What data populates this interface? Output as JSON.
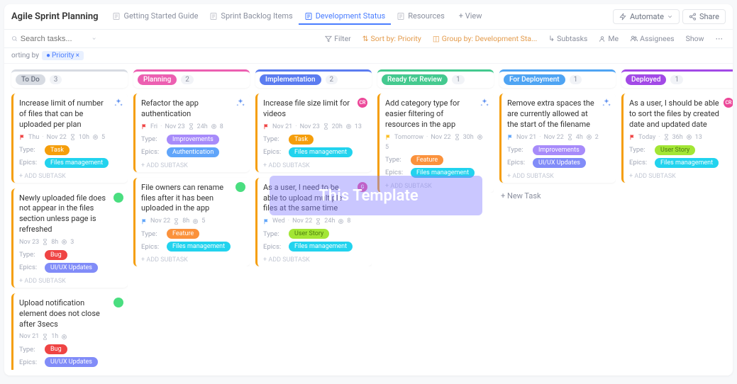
{
  "title": "Agile Sprint Planning",
  "tabs": [
    {
      "label": "Getting Started Guide",
      "active": false
    },
    {
      "label": "Sprint Backlog Items",
      "active": false
    },
    {
      "label": "Development Status",
      "active": true
    },
    {
      "label": "Resources",
      "active": false
    }
  ],
  "add_view": "+ View",
  "top_buttons": {
    "automate": "Automate",
    "share": "Share"
  },
  "toolbar": {
    "search_placeholder": "Search tasks...",
    "filter": "Filter",
    "sort": "Sort by: Priority",
    "group": "Group by: Development Sta...",
    "subtasks": "Subtasks",
    "me": "Me",
    "assignees": "Assignees",
    "show": "Show"
  },
  "sortbar": {
    "prefix": "orting by",
    "chip": "Priority"
  },
  "columns": [
    {
      "name": "To Do",
      "color": "#d7dbe2",
      "count": 3,
      "muted": true
    },
    {
      "name": "Planning",
      "color": "#ec5fb1",
      "count": 2
    },
    {
      "name": "Implementation",
      "color": "#5b7cf0",
      "count": 2
    },
    {
      "name": "Ready for Review",
      "color": "#44c98f",
      "count": 1
    },
    {
      "name": "For Deployment",
      "color": "#4fa4f3",
      "count": 1
    },
    {
      "name": "Deployed",
      "color": "#a249e6",
      "count": 1
    }
  ],
  "prio_colors": {
    "urgent": "#ef4444",
    "high": "#f59e0b",
    "normal": "#60a5fa",
    "low": "#9ca3af"
  },
  "cards": {
    "c0": [
      {
        "title": "Increase limit of number of files that can be uploaded per plan",
        "icon": "sparkle",
        "p": "#f59e0b",
        "flagc": "mflag-red",
        "meta": [
          "Thu",
          "·",
          "Nov 22",
          "⧖",
          "10h",
          "◎",
          "5"
        ],
        "type": "task",
        "typeL": "Task",
        "epic": "fm",
        "epicL": "Files management"
      },
      {
        "title": "Newly uploaded file does not appear in the files section unless page is refreshed",
        "icon": "avatar",
        "p": "#f59e0b",
        "meta": [
          "Nov 23",
          "⧖",
          "8h",
          "◎",
          "3"
        ],
        "type": "bug",
        "typeL": "Bug",
        "epic": "uiux",
        "epicL": "UI/UX Updates"
      },
      {
        "title": "Upload notification element does not close after 3secs",
        "icon": "avatar",
        "p": "#f59e0b",
        "meta": [
          "Nov 21",
          "⧖",
          "1h",
          "◎"
        ],
        "type": "bug",
        "typeL": "Bug",
        "epic": "uiux",
        "epicL": "UI/UX Updates"
      }
    ],
    "c1": [
      {
        "title": "Refactor the app authentication",
        "icon": "sparkle",
        "p": "#f59e0b",
        "flagc": "mflag-red",
        "meta": [
          "Fri",
          "·",
          "Nov 23",
          "⧖",
          "24h",
          "◎",
          "8"
        ],
        "type": "impr",
        "typeL": "Improvements",
        "epic": "auth",
        "epicL": "Authentication"
      },
      {
        "title": "File owners can rename files after it has been uploaded in the app",
        "icon": "avatar",
        "p": "#f59e0b",
        "flagc": "mflag-blue",
        "meta": [
          "Nov 22",
          "⧖",
          "8h",
          "◎",
          "5"
        ],
        "type": "feature",
        "typeL": "Feature",
        "epic": "fm",
        "epicL": "Files management"
      }
    ],
    "c2": [
      {
        "title": "Increase file size limit for videos",
        "icon": "pink",
        "iconT": "CR",
        "p": "#f59e0b",
        "flagc": "mflag-red",
        "meta": [
          "Nov 21",
          "·",
          "Nov 23",
          "⧖",
          "20h",
          "◎",
          "13"
        ],
        "type": "task",
        "typeL": "Task",
        "epic": "fm",
        "epicL": "Files management"
      },
      {
        "title": "As a user, I need to be able to upload multiple files at the same time",
        "icon": "pink",
        "iconT": "G",
        "p": "#f59e0b",
        "flagc": "mflag-blue",
        "meta": [
          "Wed",
          "·",
          "Nov 22",
          "⧖",
          "24h",
          "◎",
          "8"
        ],
        "type": "ustory",
        "typeL": "User Story",
        "epic": "fm",
        "epicL": "Files management"
      }
    ],
    "c3": [
      {
        "title": "Add category type for easier filtering of resources in the app",
        "icon": "sparkle",
        "p": "#f59e0b",
        "flagc": "mflag-yellow",
        "meta": [
          "Tomorrow",
          "·",
          "Nov 22",
          "⧖",
          "30h",
          "◎",
          "5"
        ],
        "type": "feature",
        "typeL": "Feature",
        "epic": "fm",
        "epicL": "Files management"
      }
    ],
    "c4": [
      {
        "title": "Remove extra spaces the are currently allowed at the start of the filename",
        "icon": "sparkle",
        "p": "#f59e0b",
        "flagc": "mflag-blue",
        "meta": [
          "Nov 21",
          "·",
          "Nov 22",
          "⧖",
          "4h",
          "◎",
          "2"
        ],
        "type": "impr",
        "typeL": "Improvements",
        "epic": "uiux",
        "epicL": "UI/UX Updates"
      }
    ],
    "c5": [
      {
        "title": "As a user, I should be able to sort the files by created date and updated date",
        "icon": "pink",
        "iconT": "CR",
        "p": "#f59e0b",
        "flagc": "mflag-red",
        "meta": [
          "Today",
          "·",
          "⧖",
          "36h",
          "◎",
          "13"
        ],
        "type": "ustory",
        "typeL": "User Story",
        "epic": "fm",
        "epicL": "Files management"
      }
    ]
  },
  "addsub": "+ ADD SUBTASK",
  "newtask": "+ New Task",
  "row_labels": {
    "type": "Type:",
    "epics": "Epics:"
  },
  "watermark": "This Template"
}
